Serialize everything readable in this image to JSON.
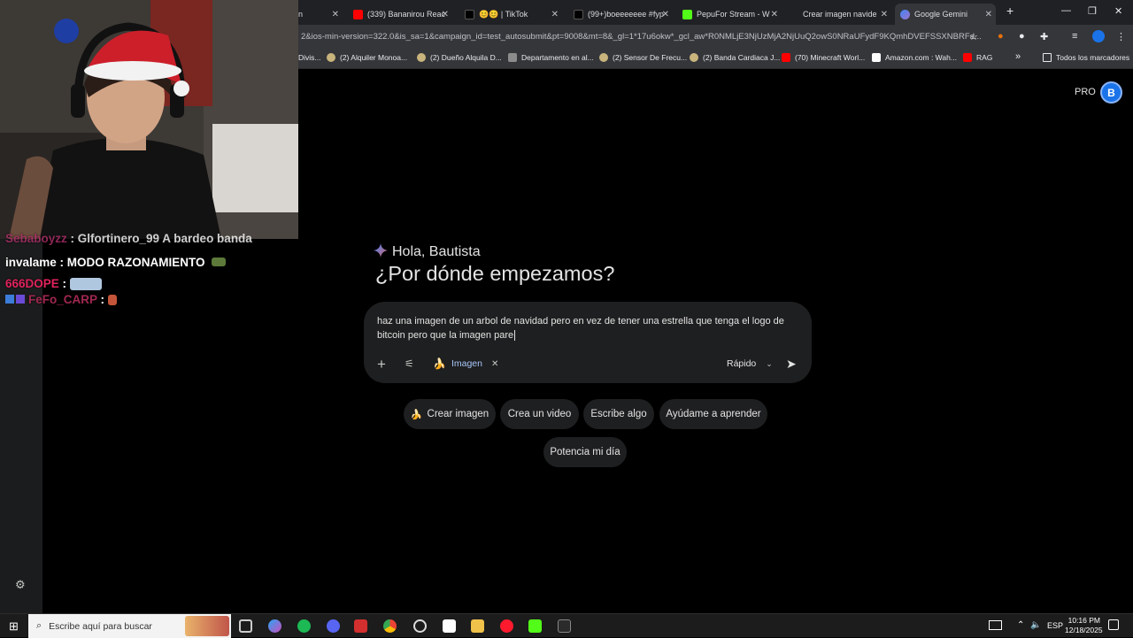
{
  "browser": {
    "tabs": [
      {
        "label": "n",
        "favicon_color": "#202124"
      },
      {
        "label": "(339) Bananirou Reac",
        "favicon_color": "#ff0000"
      },
      {
        "label": "😊😊 | TikTok",
        "favicon_color": "#000000"
      },
      {
        "label": "(99+)boeeeeeee #fyp",
        "favicon_color": "#000000"
      },
      {
        "label": "PepuFor Stream - W",
        "favicon_color": "#53fc18"
      },
      {
        "label": "Crear imagen navide",
        "favicon_color": "#202124"
      },
      {
        "label": "Google Gemini",
        "favicon_color": "#4285f4"
      }
    ],
    "url": "2&ios-min-version=322.0&is_sa=1&campaign_id=test_autosubmit&pt=9008&mt=8&_gl=1*17u6okw*_gcl_aw*R0NMLjE3NjUzMjA2NjUuQ2owS0NRaUFydF9KQmhDVEFSSXNBRFa...",
    "bookmarks": [
      "Divis...",
      "(2) Alquiler Monoa...",
      "(2) Dueño Alquila D...",
      "Departamento en al...",
      "(2) Sensor De Frecu...",
      "(2) Banda Cardiaca J...",
      "(70) Minecraft Worl...",
      "Amazon.com : Wah...",
      "RAG"
    ],
    "all_bookmarks": "Todos los marcadores"
  },
  "chat": {
    "lines": [
      {
        "user": "Sebaboyzz",
        "message": "Glfortinero_99 A bardeo banda",
        "color": "#b0306a"
      },
      {
        "user": "invalame",
        "message": "MODO RAZONAMIENTO",
        "color": "#ffffff"
      },
      {
        "user": "666DOPE",
        "message": "",
        "color": "#e0235d"
      },
      {
        "user": "FeFo_CARP",
        "message": "",
        "color": "#a0284f"
      }
    ]
  },
  "gemini": {
    "plan_badge": "PRO",
    "avatar_letter": "B",
    "greeting": "Hola, Bautista",
    "headline": "¿Por dónde empezamos?",
    "prompt_text": "haz una imagen de un arbol de navidad pero en vez de tener una estrella que tenga el logo de bitcoin pero que la imagen pare",
    "tool_chip": "Imagen",
    "mode": "Rápido",
    "suggestions": [
      "Crear imagen",
      "Crea un video",
      "Escribe algo",
      "Ayúdame a aprender",
      "Potencia mi día"
    ]
  },
  "taskbar": {
    "search_placeholder": "Escribe aquí para buscar",
    "language": "ESP",
    "time": "10:16 PM",
    "date": "12/18/2025"
  },
  "colors": {
    "accent_blue": "#a8c7fa",
    "surface": "#1e1f20",
    "background": "#000000"
  }
}
